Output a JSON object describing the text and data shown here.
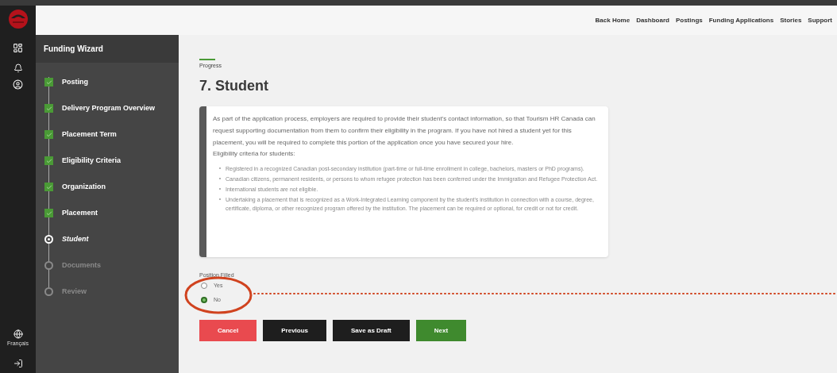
{
  "rail": {
    "language": "Français"
  },
  "top_nav": [
    "Back Home",
    "Dashboard",
    "Postings",
    "Funding Applications",
    "Stories",
    "Support"
  ],
  "sidebar": {
    "title": "Funding Wizard",
    "steps": [
      {
        "label": "Posting",
        "completed": true,
        "selected": false
      },
      {
        "label": "Delivery Program Overview",
        "completed": true,
        "selected": false
      },
      {
        "label": "Placement Term",
        "completed": true,
        "selected": false
      },
      {
        "label": "Eligibility Criteria",
        "completed": true,
        "selected": false
      },
      {
        "label": "Organization",
        "completed": true,
        "selected": false
      },
      {
        "label": "Placement",
        "completed": true,
        "selected": false
      },
      {
        "label": "Student",
        "completed": false,
        "selected": true
      },
      {
        "label": "Documents",
        "completed": false,
        "selected": false
      },
      {
        "label": "Review",
        "completed": false,
        "selected": false
      }
    ]
  },
  "progress": {
    "label": "Progress",
    "level": 0.05
  },
  "heading": "7. Student",
  "info": {
    "paragraph": "As part of the application process, employers are required to provide their student's contact information, so that Tourism HR Canada can request supporting documentation from them to confirm their eligibility in the program. If you have not hired a student yet for this placement, you will be required to complete this portion of the application once you have secured your hire.",
    "subheading": "Eligibility criteria for students:",
    "bullets": [
      "Registered in a recognized Canadian post-secondary institution (part-time or full-time enrollment in college, bachelors, masters or PhD programs).",
      "Canadian citizens, permanent residents, or persons to whom refugee protection has been conferred under the Immigration and Refugee Protection Act.",
      "International students are not eligible.",
      "Undertaking a placement that is recognized as a Work-Integrated Learning component by the student's institution in connection with a course, degree, certificate, diploma, or other recognized program offered by the institution. The placement can be required or optional, for credit or not for credit."
    ]
  },
  "position_filled": {
    "label": "Position Filled",
    "options": [
      {
        "label": "Yes",
        "selected": false
      },
      {
        "label": "No",
        "selected": true
      }
    ]
  },
  "buttons": [
    {
      "label": "Cancel",
      "kind": "danger"
    },
    {
      "label": "Previous",
      "kind": "dark"
    },
    {
      "label": "Save as Draft",
      "kind": "dark"
    },
    {
      "label": "Next",
      "kind": "primary"
    }
  ]
}
